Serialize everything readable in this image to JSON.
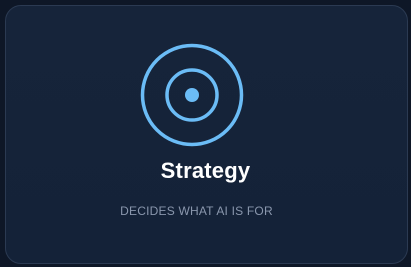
{
  "card": {
    "icon": "target-icon",
    "title": "Strategy",
    "subtitle": "DECIDES WHAT AI IS FOR"
  },
  "colors": {
    "background": "#0e1727",
    "card_background": "#16243a",
    "card_border": "#2b3a52",
    "accent": "#6bbcf6",
    "title": "#ffffff",
    "subtitle": "#8a97ad"
  }
}
